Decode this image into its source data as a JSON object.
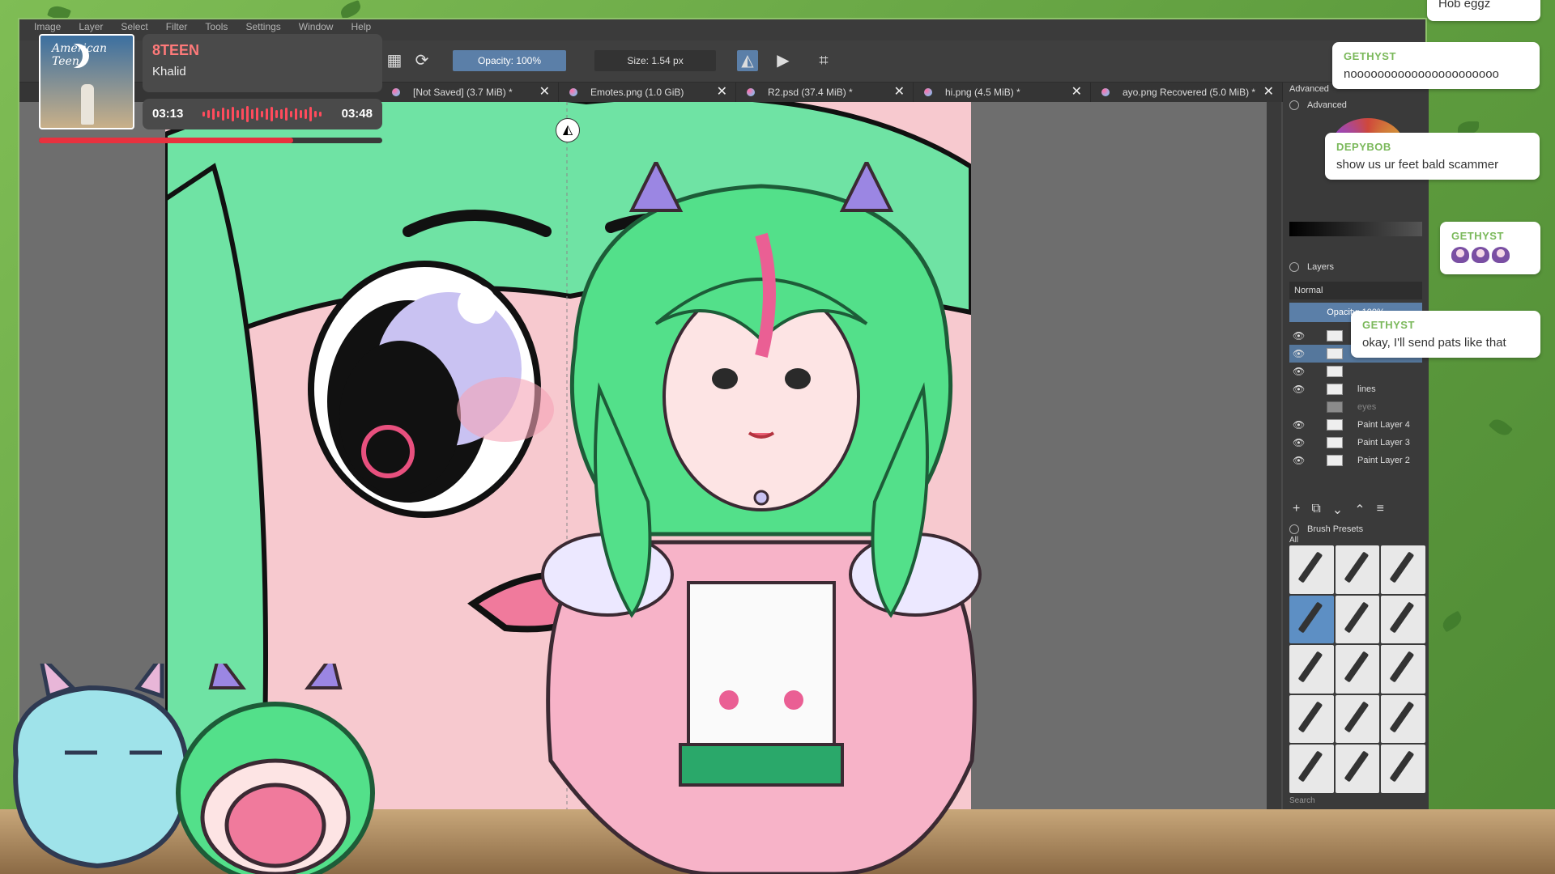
{
  "menubar": [
    "Image",
    "Layer",
    "Select",
    "Filter",
    "Tools",
    "Settings",
    "Window",
    "Help"
  ],
  "toolbar": {
    "opacity_label": "Opacity: 100%",
    "size_label": "Size: 1.54 px"
  },
  "tabs": [
    {
      "label": "[Not Saved] (3.7 MiB) *"
    },
    {
      "label": "Emotes.png (1.0 GiB)"
    },
    {
      "label": "R2.psd (37.4 MiB) *"
    },
    {
      "label": "hi.png (4.5 MiB) *"
    },
    {
      "label": "ayo.png Recovered (5.0 MiB) *"
    }
  ],
  "dock": {
    "advanced_1": "Advanced",
    "advanced_2": "Advanced",
    "layers_title": "Layers",
    "blend_mode": "Normal",
    "layer_opacity": "Opacity:  100%",
    "layers": [
      {
        "name": ""
      },
      {
        "name": ""
      },
      {
        "name": ""
      },
      {
        "name": "lines"
      },
      {
        "name": "eyes"
      },
      {
        "name": "Paint Layer 4"
      },
      {
        "name": "Paint Layer 3"
      },
      {
        "name": "Paint Layer 2"
      }
    ],
    "brush_presets_title": "Brush Presets",
    "brush_filter": "All",
    "brush_search": "Search"
  },
  "music": {
    "album_text": "American Teen",
    "title": "8TEEN",
    "artist": "Khalid",
    "current_time": "03:13",
    "end_time": "03:48",
    "progress": 0.74,
    "accent": "#e8323f"
  },
  "chat": [
    {
      "user": "",
      "text": "Hob eggz"
    },
    {
      "user": "GETHYST",
      "text": "noooooooooooooooooooooo"
    },
    {
      "user": "DEPYBOB",
      "text": "show us ur feet bald scammer"
    },
    {
      "user": "GETHYST",
      "emotes": 3
    },
    {
      "user": "GETHYST",
      "text": "okay, I'll send pats like that"
    }
  ],
  "colors": {
    "krita_bg": "#4a4a4a",
    "selection_blue": "#5b7fa8",
    "chat_user_green": "#7ab85a",
    "background_green": "#6fa84a"
  }
}
